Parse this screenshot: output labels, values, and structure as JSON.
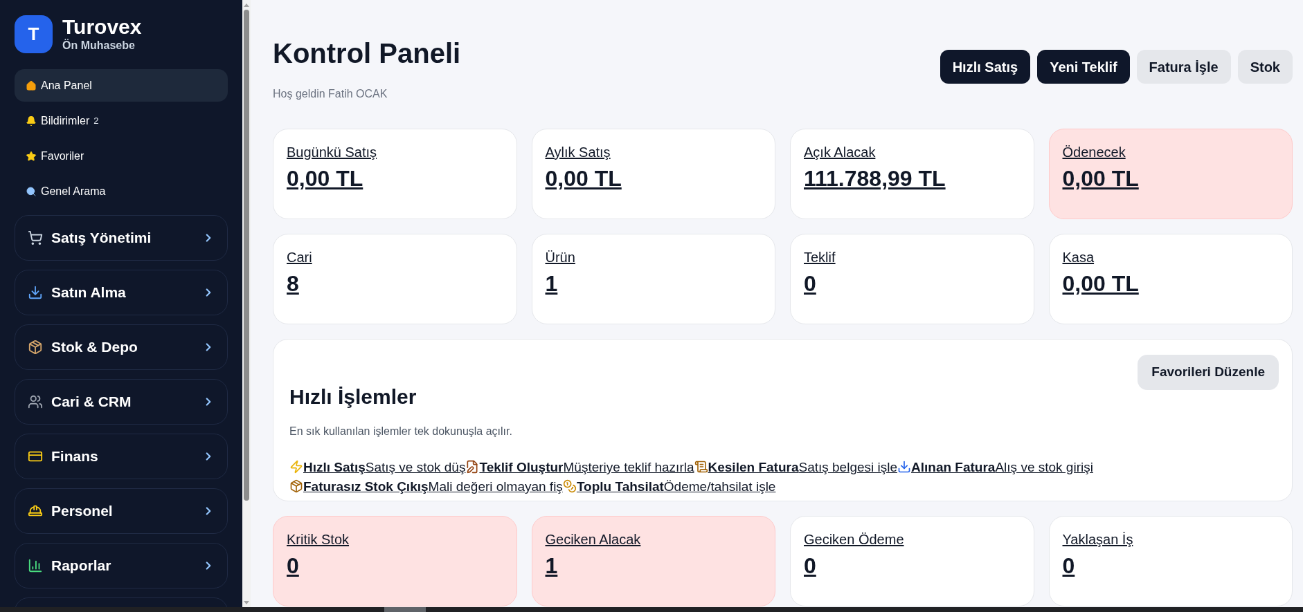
{
  "sidebar": {
    "brand": {
      "logo_letter": "T",
      "name": "Turovex",
      "subtitle": "Ön Muhasebe"
    },
    "items": [
      {
        "label": "Ana Panel",
        "selected": true
      },
      {
        "label": "Bildirimler",
        "badge": "2",
        "selected": false
      },
      {
        "label": "Favoriler",
        "selected": false
      },
      {
        "label": "Genel Arama",
        "selected": false
      }
    ],
    "groups": [
      {
        "label": "Satış Yönetimi",
        "expanded": false
      },
      {
        "label": "Satın Alma",
        "expanded": false
      },
      {
        "label": "Stok & Depo",
        "expanded": false
      },
      {
        "label": "Cari & CRM",
        "expanded": false
      },
      {
        "label": "Finans",
        "expanded": false
      },
      {
        "label": "Personel",
        "expanded": false
      },
      {
        "label": "Raporlar",
        "expanded": false
      }
    ]
  },
  "header": {
    "title": "Kontrol Paneli",
    "subtitle": "Hoş geldin Fatih OCAK",
    "buttons": [
      {
        "label": "Hızlı Satış",
        "kind": "primary"
      },
      {
        "label": "Yeni Teklif",
        "kind": "primary"
      },
      {
        "label": "Fatura İşle",
        "kind": "secondary"
      },
      {
        "label": "Stok",
        "kind": "secondary"
      }
    ]
  },
  "stats_top": [
    {
      "label": "Bugünkü Satış",
      "value": "0,00 TL",
      "kind": "normal"
    },
    {
      "label": "Aylık Satış",
      "value": "0,00 TL",
      "kind": "normal"
    },
    {
      "label": "Açık Alacak",
      "value": "111.788,99 TL",
      "kind": "normal"
    },
    {
      "label": "Ödenecek",
      "value": "0,00 TL",
      "kind": "alert"
    },
    {
      "label": "Cari",
      "value": "8",
      "kind": "normal"
    },
    {
      "label": "Ürün",
      "value": "1",
      "kind": "normal"
    },
    {
      "label": "Teklif",
      "value": "0",
      "kind": "normal"
    },
    {
      "label": "Kasa",
      "value": "0,00 TL",
      "kind": "normal"
    }
  ],
  "quick_actions": {
    "title": "Hızlı İşlemler",
    "subtitle": "En sık kullanılan işlemler tek dokunuşla açılır.",
    "edit_button": "Favorileri Düzenle",
    "actions": [
      {
        "title": "Hızlı Satış",
        "description": "Satış ve stok düş"
      },
      {
        "title": "Teklif Oluştur",
        "description": "Müşteriye teklif hazırla"
      },
      {
        "title": "Kesilen Fatura",
        "description": "Satış belgesi işle"
      },
      {
        "title": "Alınan Fatura",
        "description": "Alış ve stok girişi"
      },
      {
        "title": "Faturasız Stok Çıkış",
        "description": "Mali değeri olmayan fiş"
      },
      {
        "title": "Toplu Tahsilat",
        "description": "Ödeme/tahsilat işle"
      }
    ]
  },
  "stats_bottom": [
    {
      "label": "Kritik Stok",
      "value": "0",
      "kind": "alert"
    },
    {
      "label": "Geciken Alacak",
      "value": "1",
      "kind": "alert"
    },
    {
      "label": "Geciken Ödeme",
      "value": "0",
      "kind": "normal"
    },
    {
      "label": "Yaklaşan İş",
      "value": "0",
      "kind": "normal"
    }
  ]
}
